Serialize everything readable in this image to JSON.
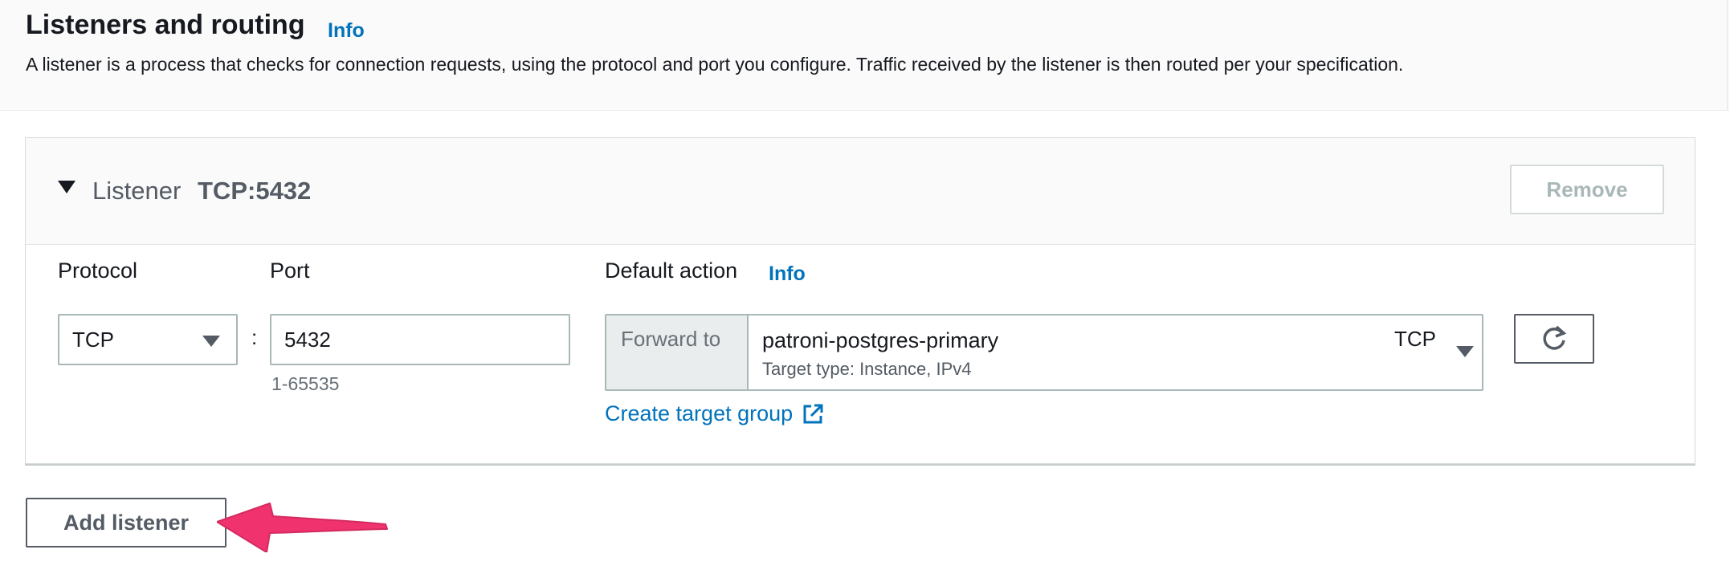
{
  "section": {
    "title": "Listeners and routing",
    "info_label": "Info",
    "description": "A listener is a process that checks for connection requests, using the protocol and port you configure. Traffic received by the listener is then routed per your specification."
  },
  "listener": {
    "label": "Listener",
    "name": "TCP:5432",
    "remove_label": "Remove",
    "protocol_label": "Protocol",
    "protocol_value": "TCP",
    "separator": ":",
    "port_label": "Port",
    "port_value": "5432",
    "port_hint": "1-65535",
    "default_action_label": "Default action",
    "default_action_info": "Info",
    "forward_label": "Forward to",
    "target_group_name": "patroni-postgres-primary",
    "target_group_type": "Target type: Instance, IPv4",
    "target_group_protocol": "TCP",
    "create_target_group_label": "Create target group"
  },
  "add_listener_label": "Add listener",
  "icons": {
    "expand": "caret-down-icon",
    "dropdown": "chevron-down-icon",
    "external": "external-link-icon",
    "refresh": "refresh-icon",
    "annotation": "arrow-annotation"
  },
  "colors": {
    "link": "#0073bb",
    "annotation": "#f0326e",
    "border": "#aab7b8",
    "text": "#16191f"
  }
}
